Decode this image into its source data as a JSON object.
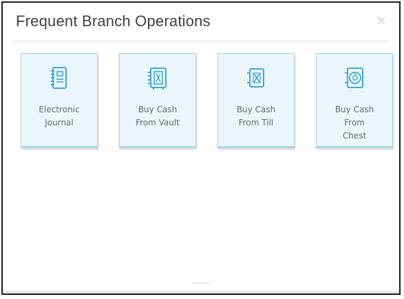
{
  "panel": {
    "title": "Frequent Branch Operations",
    "close_icon": "close-icon"
  },
  "colors": {
    "tile_background": "#eaf6fc",
    "tile_border": "#9fd4ee",
    "icon_color": "#3fa9d7",
    "title_color": "#404040",
    "label_color": "#5c6a72"
  },
  "tiles": [
    {
      "label_line1": "Electronic",
      "label_line2": "Journal",
      "label_line3": "",
      "icon": "journal-book-icon"
    },
    {
      "label_line1": "Buy Cash",
      "label_line2": "From Vault",
      "label_line3": "",
      "icon": "vault-safe-icon"
    },
    {
      "label_line1": "Buy Cash",
      "label_line2": "From Till",
      "label_line3": "",
      "icon": "till-icon"
    },
    {
      "label_line1": "Buy Cash",
      "label_line2": "From",
      "label_line3": "Chest",
      "icon": "cash-chest-icon"
    }
  ]
}
